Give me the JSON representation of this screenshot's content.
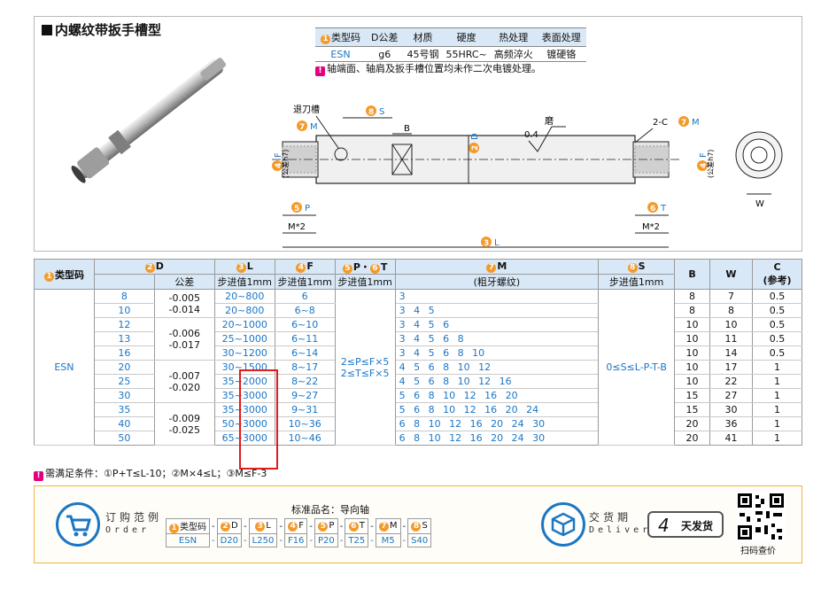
{
  "title": "内螺纹带扳手槽型",
  "spec_table": {
    "headers": [
      "类型码",
      "D公差",
      "材质",
      "硬度",
      "热处理",
      "表面处理"
    ],
    "header_nums": [
      "1"
    ],
    "row": [
      "ESN",
      "g6",
      "45号钢",
      "55HRC~",
      "高频淬火",
      "镀硬铬"
    ],
    "note": "轴端面、轴肩及扳手槽位置均未作二次电镀处理。"
  },
  "drawing": {
    "label_tuidaocao": "退刀槽",
    "label_s": "S",
    "label_m_left": "M",
    "label_m_right": "M",
    "label_b": "B",
    "label_d": "D",
    "label_04": "0.4",
    "label_mo": "磨",
    "label_2c": "2-C",
    "label_f": "F",
    "label_f_tol": "(公差h7)",
    "label_p": "P",
    "label_t": "T",
    "label_m2": "M*2",
    "label_l": "L",
    "label_w": "W",
    "n1": "1",
    "n2": "2",
    "n3": "3",
    "n4": "4",
    "n5": "5",
    "n6": "6",
    "n7": "7",
    "n8": "8"
  },
  "main_table": {
    "h_type": "类型码",
    "h_d": "D",
    "h_d_tol": "公差",
    "h_l": "L",
    "h_l_sub": "步进值1mm",
    "h_f": "F",
    "h_f_sub": "步进值1mm",
    "h_pt": "P・",
    "h_pt2": "T",
    "h_pt_sub": "步进值1mm",
    "h_m": "M",
    "h_m_sub": "(粗牙螺纹)",
    "h_s": "S",
    "h_s_sub": "步进值1mm",
    "h_b": "B",
    "h_w": "W",
    "h_c": "C",
    "h_c_sub": "(参考)",
    "type_code": "ESN",
    "pt_rule1": "2≤P≤F×5",
    "pt_rule2": "2≤T≤F×5",
    "s_rule": "0≤S≤L-P-T-B",
    "tol_groups": [
      {
        "a": "-0.005",
        "b": "-0.014"
      },
      {
        "a": "-0.006",
        "b": "-0.017"
      },
      {
        "a": "-0.007",
        "b": "-0.020"
      },
      {
        "a": "-0.009",
        "b": "-0.025"
      }
    ],
    "rows": [
      {
        "d": "8",
        "l": "20~800",
        "f": "6",
        "m": "3",
        "b": "8",
        "w": "7",
        "c": "0.5"
      },
      {
        "d": "10",
        "l": "20~800",
        "f": "6~8",
        "m": "3 4 5",
        "b": "8",
        "w": "8",
        "c": "0.5"
      },
      {
        "d": "12",
        "l": "20~1000",
        "f": "6~10",
        "m": "3 4 5 6",
        "b": "10",
        "w": "10",
        "c": "0.5"
      },
      {
        "d": "13",
        "l": "25~1000",
        "f": "6~11",
        "m": "3 4 5 6 8",
        "b": "10",
        "w": "11",
        "c": "0.5"
      },
      {
        "d": "16",
        "l": "30~1200",
        "f": "6~14",
        "m": "3 4 5 6 8 10",
        "b": "10",
        "w": "14",
        "c": "0.5"
      },
      {
        "d": "20",
        "l": "30~1500",
        "f": "8~17",
        "m": "4 5 6 8 10 12",
        "b": "10",
        "w": "17",
        "c": "1"
      },
      {
        "d": "25",
        "l": "35~2000",
        "f": "8~22",
        "m": "4 5 6 8 10 12 16",
        "b": "10",
        "w": "22",
        "c": "1"
      },
      {
        "d": "30",
        "l": "35~3000",
        "f": "9~27",
        "m": "5 6 8 10 12 16 20",
        "b": "15",
        "w": "27",
        "c": "1"
      },
      {
        "d": "35",
        "l": "35~3000",
        "f": "9~31",
        "m": "5 6 8 10 12 16 20 24",
        "b": "15",
        "w": "30",
        "c": "1"
      },
      {
        "d": "40",
        "l": "50~3000",
        "f": "10~36",
        "m": "6 8 10 12 16 20 24 30",
        "b": "20",
        "w": "36",
        "c": "1"
      },
      {
        "d": "50",
        "l": "65~3000",
        "f": "10~46",
        "m": "6 8 10 12 16 20 24 30",
        "b": "20",
        "w": "41",
        "c": "1"
      }
    ],
    "condition": "需满足条件：①P+T≤L-10；②M×4≤L；③M≤F-3"
  },
  "order": {
    "label_cn": "订购范例",
    "label_en": "Order",
    "std_name": "标准品名：导向轴",
    "headers": [
      "类型码",
      "D",
      "L",
      "F",
      "P",
      "T",
      "M",
      "S"
    ],
    "values": [
      "ESN",
      "D20",
      "L250",
      "F16",
      "P20",
      "T25",
      "M5",
      "S40"
    ],
    "delivery_cn": "交货期",
    "delivery_en": "Delivery",
    "days": "4",
    "days_label": "天发货",
    "qr_label": "扫码查价"
  },
  "colors": {
    "accent_blue": "#1a76c6",
    "header_bg": "#d9e8f6",
    "orange": "#f39a2b",
    "magenta": "#e4007f",
    "highlight": "#e21b1b"
  }
}
